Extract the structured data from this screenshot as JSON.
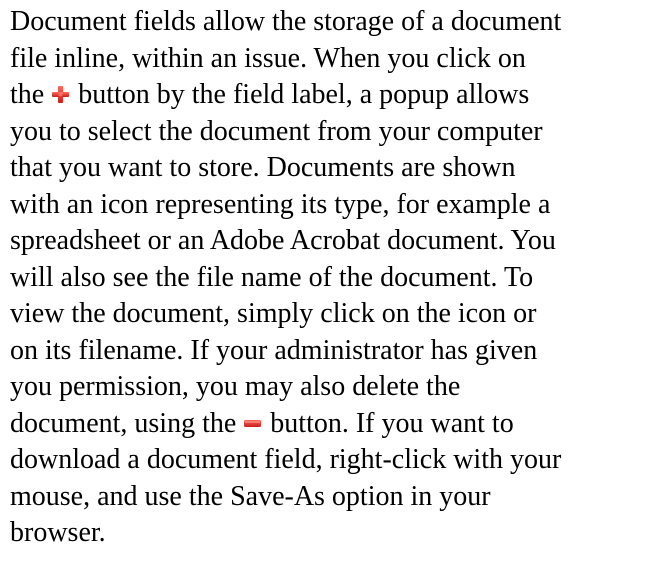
{
  "paragraph": {
    "line1": "Document fields allow the storage of a document",
    "line2": "file inline, within an issue. When you click on",
    "line3_before_icon": "the ",
    "line3_after_icon": " button by the field label, a popup allows",
    "line4": "you to select the document from your computer",
    "line5": "that you want to store. Documents are shown",
    "line6": "with an icon representing its type, for example a",
    "line7": "spreadsheet or an Adobe Acrobat document. You",
    "line8": "will also see the file name of the document. To",
    "line9": "view the document, simply click on the icon or",
    "line10": "on its filename. If your administrator has given",
    "line11": "you permission, you may also delete the",
    "line12_before_icon": "document, using the ",
    "line12_after_icon": " button. If you want to",
    "line13": "download a document field, right-click with your",
    "line14": "mouse, and use the Save-As option in your",
    "line15": "browser."
  },
  "icons": {
    "add": "plus-icon",
    "delete": "minus-icon"
  },
  "colors": {
    "text": "#000000",
    "icon_red": "#e8302c",
    "icon_red_dark": "#c81e1a"
  }
}
